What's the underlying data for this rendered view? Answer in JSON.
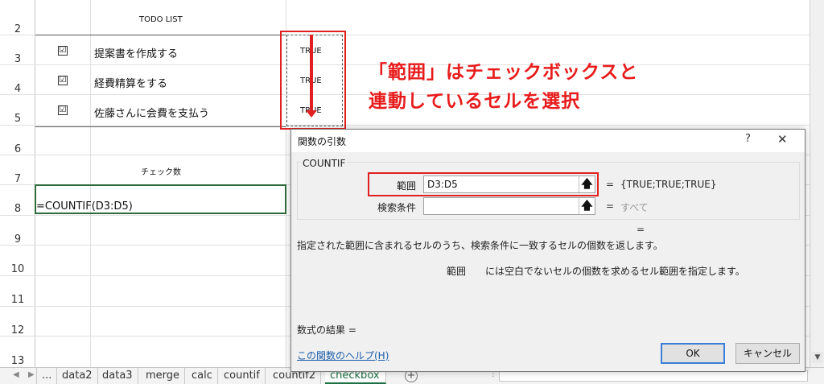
{
  "sheet": {
    "row_numbers": [
      "2",
      "3",
      "4",
      "5",
      "6",
      "7",
      "8",
      "9",
      "10",
      "11",
      "12",
      "13"
    ],
    "todo_header": "TODO LIST",
    "todos": [
      {
        "checked": "☑",
        "task": "提案書を作成する",
        "value": "TRUE"
      },
      {
        "checked": "☑",
        "task": "経費精算をする",
        "value": "TRUE"
      },
      {
        "checked": "☑",
        "task": "佐藤さんに会費を支払う",
        "value": "TRUE"
      }
    ],
    "count_header": "チェック数",
    "formula": "=COUNTIF(D3:D5)"
  },
  "annotation": {
    "line1": "「範囲」はチェックボックスと",
    "line2": "連動しているセルを選択",
    "color": "#e81c1c"
  },
  "tabs": {
    "ellipsis": "...",
    "items": [
      "data2",
      "data3",
      "merge",
      "calc",
      "countif",
      "countif2",
      "checkbox"
    ],
    "active": "checkbox",
    "add_label": "+"
  },
  "dialog": {
    "title": "関数の引数",
    "help_button": "?",
    "close_button": "✕",
    "function_name": "COUNTIF",
    "args": [
      {
        "label": "範囲",
        "value": "D3:D5",
        "result": "{TRUE;TRUE;TRUE}"
      },
      {
        "label": "検索条件",
        "value": "",
        "result": "すべて"
      }
    ],
    "equals": "=",
    "description": "指定された範囲に含まれるセルのうち、検索条件に一致するセルの個数を返します。",
    "arg_help_name": "範囲",
    "arg_help_text": "には空白でないセルの個数を求めるセル範囲を指定します。",
    "formula_result_label": "数式の結果 =",
    "help_link": "この関数のヘルプ(H)",
    "ok_label": "OK",
    "cancel_label": "キャンセル"
  }
}
